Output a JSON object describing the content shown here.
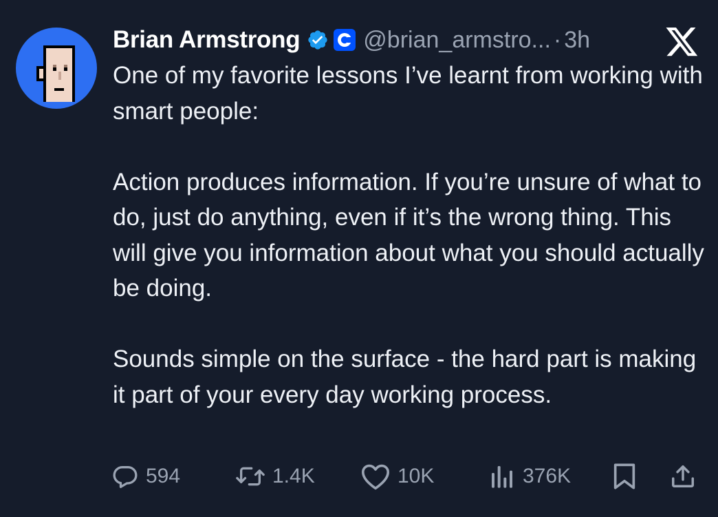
{
  "tweet": {
    "author_name": "Brian Armstrong",
    "handle": "@brian_armstro...",
    "separator": "·",
    "time": "3h",
    "paragraphs": [
      "One of my favorite lessons I’ve learnt from working with smart people:",
      "Action produces information. If you’re unsure of what to do, just do anything, even if it’s the wrong thing. This will give you information about what you should actually be doing.",
      "Sounds simple on the surface - the hard part is making it part of your every day working process."
    ]
  },
  "actions": {
    "replies": "594",
    "reposts": "1.4K",
    "likes": "10K",
    "views": "376K"
  },
  "icons": {
    "verified": "verified-badge-icon",
    "affiliate": "coinbase-icon",
    "platform": "x-logo-icon",
    "reply": "reply-icon",
    "repost": "repost-icon",
    "like": "heart-icon",
    "views": "views-icon",
    "bookmark": "bookmark-icon",
    "share": "share-icon"
  },
  "colors": {
    "background": "#151c2b",
    "text": "#eef1f6",
    "muted": "#9aa3b2",
    "verified": "#1d9bf0",
    "coinbase": "#0052ff",
    "avatar_bg": "#2d6ff2"
  }
}
